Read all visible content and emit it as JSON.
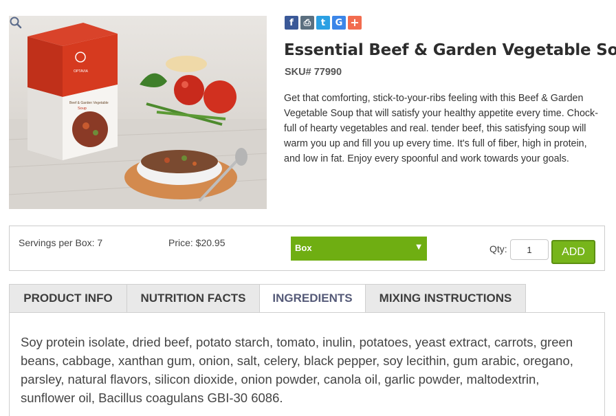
{
  "product": {
    "title": "Essential Beef & Garden Vegetable Soup",
    "sku": "SKU# 77990",
    "description": "Get that comforting, stick-to-your-ribs feeling with this Beef & Garden Vegetable Soup that will satisfy your healthy appetite every time. Chock-full of hearty vegetables and real. tender beef, this satisfying soup will warm you up and fill you up every time. It's full of fiber, high in protein, and low in fat. Enjoy every spoonful and work towards your goals.",
    "image": {
      "box_brand": "OPTAVIA",
      "box_title": "Beef & Garden Vegetable",
      "box_subtitle": "Soup"
    }
  },
  "share": {
    "icons": [
      "facebook-icon",
      "print-icon",
      "twitter-icon",
      "google-icon",
      "more-share-icon"
    ],
    "glyphs": [
      "f",
      "⎙",
      "t",
      "G",
      "+"
    ]
  },
  "purchase": {
    "servings": "Servings per Box: 7",
    "price": "Price: $20.95",
    "size_selected": "Box",
    "qty_label": "Qty:",
    "qty_value": "1",
    "add_label": "ADD"
  },
  "tabs": [
    {
      "label": "PRODUCT INFO",
      "active": false
    },
    {
      "label": "NUTRITION FACTS",
      "active": false
    },
    {
      "label": "INGREDIENTS",
      "active": true
    },
    {
      "label": "MIXING INSTRUCTIONS",
      "active": false
    }
  ],
  "ingredients_text": "Soy protein isolate, dried beef, potato starch, tomato, inulin, potatoes, yeast extract, carrots, green beans, cabbage, xanthan gum, onion, salt, celery, black pepper, soy lecithin, gum arabic, oregano, parsley, natural flavors, silicon dioxide, onion powder, canola oil, garlic powder, maltodextrin, sunflower oil, Bacillus coagulans GBI-30 6086.",
  "colors": {
    "accent_green": "#77b51b",
    "select_green": "#6fae12",
    "box_red": "#c9361c"
  }
}
